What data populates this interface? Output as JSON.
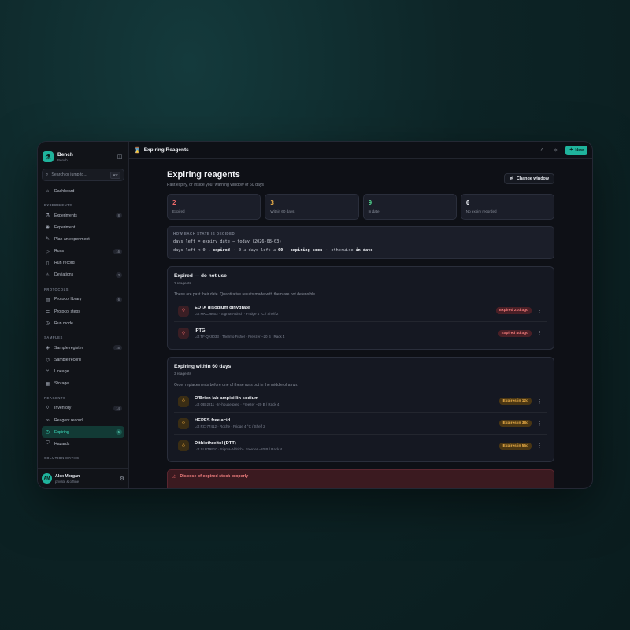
{
  "app": {
    "name": "Bench",
    "subtitle": "Bench"
  },
  "search": {
    "placeholder": "Search or jump to...",
    "shortcut": "⌘K"
  },
  "sidebar": {
    "top": [
      {
        "label": "Dashboard",
        "icon": "home-icon"
      }
    ],
    "sections": [
      {
        "title": "Experiments",
        "items": [
          {
            "label": "Experiments",
            "count": "8"
          },
          {
            "label": "Experiment",
            "count": ""
          },
          {
            "label": "Plan an experiment",
            "count": ""
          },
          {
            "label": "Runs",
            "count": "16"
          },
          {
            "label": "Run record",
            "count": ""
          },
          {
            "label": "Deviations",
            "count": "3"
          }
        ]
      },
      {
        "title": "Protocols",
        "items": [
          {
            "label": "Protocol library",
            "count": "6"
          },
          {
            "label": "Protocol steps",
            "count": ""
          },
          {
            "label": "Run mode",
            "count": ""
          }
        ]
      },
      {
        "title": "Samples",
        "items": [
          {
            "label": "Sample register",
            "count": "16"
          },
          {
            "label": "Sample record",
            "count": ""
          },
          {
            "label": "Lineage",
            "count": ""
          },
          {
            "label": "Storage",
            "count": ""
          }
        ]
      },
      {
        "title": "Reagents",
        "items": [
          {
            "label": "Inventory",
            "count": "14"
          },
          {
            "label": "Reagent record",
            "count": ""
          },
          {
            "label": "Expiring",
            "count": "5"
          },
          {
            "label": "Hazards",
            "count": ""
          }
        ]
      },
      {
        "title": "Solution maths",
        "items": []
      }
    ]
  },
  "user": {
    "initials": "AM",
    "name": "Alex Morgan",
    "status": "private & offline"
  },
  "topbar": {
    "title": "Expiring Reagents",
    "new_label": "New"
  },
  "page": {
    "title": "Expiring reagents",
    "subtitle": "Past expiry, or inside your warning window of 60 days",
    "change_window_label": "Change window"
  },
  "stats": [
    {
      "value": "2",
      "label": "Expired",
      "color": "#f06a6a"
    },
    {
      "value": "3",
      "label": "Within 60 days",
      "color": "#f2b44a"
    },
    {
      "value": "9",
      "label": "In date",
      "color": "#4fd18b"
    },
    {
      "value": "0",
      "label": "No expiry recorded",
      "color": "#e5e8ee"
    }
  ],
  "rules": {
    "heading": "How each state is decided",
    "line1": "days left = expiry date − today (2026-08-03)",
    "line2_a": "days left < 0 → ",
    "line2_b": "expired",
    "line2_c": "0 ≤ days left ≤ ",
    "line2_d": "60",
    "line2_e": " → ",
    "line2_f": "expiring soon",
    "line2_g": "otherwise ",
    "line2_h": "in date"
  },
  "expired": {
    "title": "Expired — do not use",
    "count": "2 reagents",
    "note": "These are past their date. Quantitative results made with them are not defensible.",
    "items": [
      {
        "name": "EDTA disodium dihydrate",
        "meta": "Lot MKCJ8602 · Sigma-Aldrich · Fridge 4 °C / Shelf 2",
        "badge": "Expired 21d ago"
      },
      {
        "name": "IPTG",
        "meta": "Lot TF-QK9033 · Thermo Fisher · Freezer −20 B / Rack 4",
        "badge": "Expired 4d ago"
      }
    ]
  },
  "expiring": {
    "title": "Expiring within 60 days",
    "count": "3 reagents",
    "note": "Order replacements before one of these runs out in the middle of a run.",
    "items": [
      {
        "name": "O'Brien lab ampicillin sodium",
        "meta": "Lot OB-2211 · In-house prep · Freezer −20 B / Rack 4",
        "badge": "Expires in 12d"
      },
      {
        "name": "HEPES free acid",
        "meta": "Lot RC-77412 · Roche · Fridge 4 °C / Shelf 2",
        "badge": "Expires in 38d"
      },
      {
        "name": "Dithiothreitol (DTT)",
        "meta": "Lot SLBT9910 · Sigma-Aldrich · Freezer −20 B / Rack 4",
        "badge": "Expires in 55d"
      }
    ]
  },
  "alert": {
    "title": "Dispose of expired stock properly"
  }
}
